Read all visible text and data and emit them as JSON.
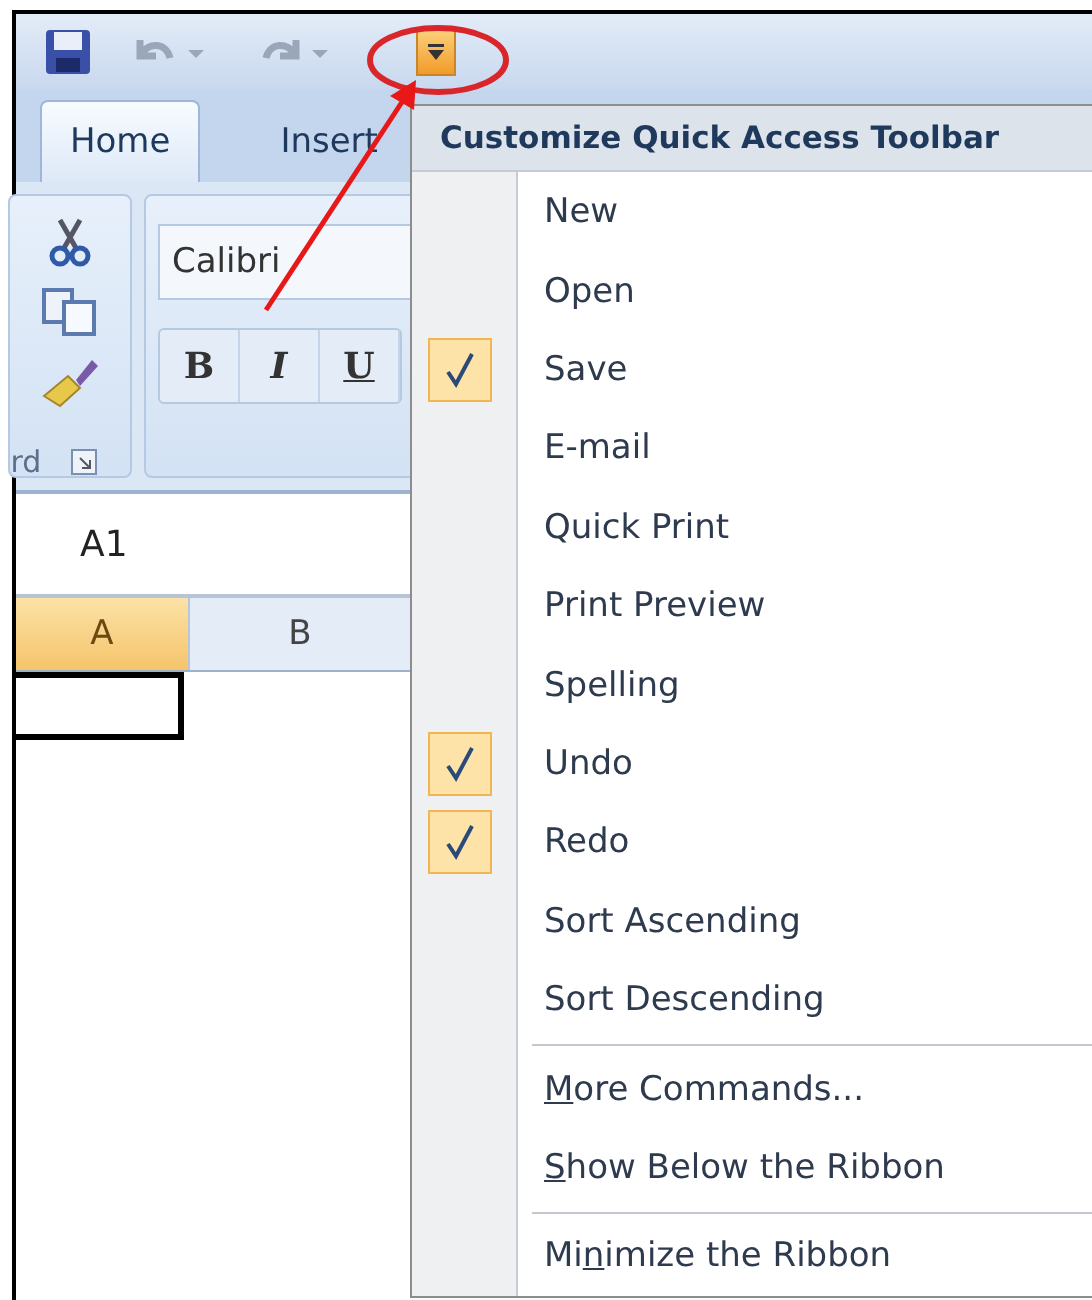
{
  "tabs": [
    {
      "label": "Home",
      "selected": true
    },
    {
      "label": "Insert",
      "selected": false
    }
  ],
  "clipboard_group": {
    "label": "rd"
  },
  "font_group": {
    "font_name": "Calibri",
    "buttons": [
      "B",
      "I",
      "U"
    ]
  },
  "name_box": {
    "value": "A1"
  },
  "columns": [
    {
      "label": "A",
      "selected": true
    },
    {
      "label": "B",
      "selected": false
    }
  ],
  "menu": {
    "title": "Customize Quick Access Toolbar",
    "items": [
      {
        "kind": "toggle",
        "label": "New",
        "checked": false
      },
      {
        "kind": "toggle",
        "label": "Open",
        "checked": false
      },
      {
        "kind": "toggle",
        "label": "Save",
        "checked": true
      },
      {
        "kind": "toggle",
        "label": "E-mail",
        "checked": false
      },
      {
        "kind": "toggle",
        "label": "Quick Print",
        "checked": false
      },
      {
        "kind": "toggle",
        "label": "Print Preview",
        "checked": false
      },
      {
        "kind": "toggle",
        "label": "Spelling",
        "checked": false
      },
      {
        "kind": "toggle",
        "label": "Undo",
        "checked": true
      },
      {
        "kind": "toggle",
        "label": "Redo",
        "checked": true
      },
      {
        "kind": "toggle",
        "label": "Sort Ascending",
        "checked": false
      },
      {
        "kind": "toggle",
        "label": "Sort Descending",
        "checked": false
      },
      {
        "kind": "separator"
      },
      {
        "kind": "command",
        "key": "M",
        "after": "ore Commands..."
      },
      {
        "kind": "command",
        "key": "S",
        "after": "how Below the Ribbon"
      },
      {
        "kind": "separator"
      },
      {
        "kind": "command",
        "before": "Mi",
        "key": "n",
        "after": "imize the Ribbon"
      }
    ]
  }
}
